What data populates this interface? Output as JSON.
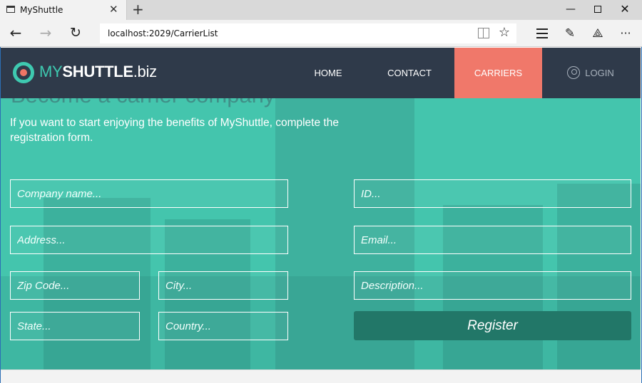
{
  "browser": {
    "tab_title": "MyShuttle",
    "tab_close": "✕",
    "new_tab": "+",
    "url": "localhost:2029/CarrierList",
    "window_minimize": "—",
    "window_close": "✕"
  },
  "site": {
    "logo_brand": "MY",
    "logo_bold": "SHUTTLE",
    "logo_suffix": ".biz",
    "nav": {
      "home": "HOME",
      "contact": "CONTACT",
      "carriers": "CARRIERS",
      "login": "LOGIN"
    },
    "accent_color": "#f0786a",
    "hero_color": "#44c5ad",
    "header_color": "#2f3a4a"
  },
  "hero": {
    "heading": "Become a carrier company",
    "intro": "If you want to start enjoying the benefits of MyShuttle, complete the registration form."
  },
  "form": {
    "company_placeholder": "Company name...",
    "id_placeholder": "ID...",
    "address_placeholder": "Address...",
    "email_placeholder": "Email...",
    "zip_placeholder": "Zip Code...",
    "city_placeholder": "City...",
    "description_placeholder": "Description...",
    "state_placeholder": "State...",
    "country_placeholder": "Country...",
    "register_label": "Register"
  }
}
